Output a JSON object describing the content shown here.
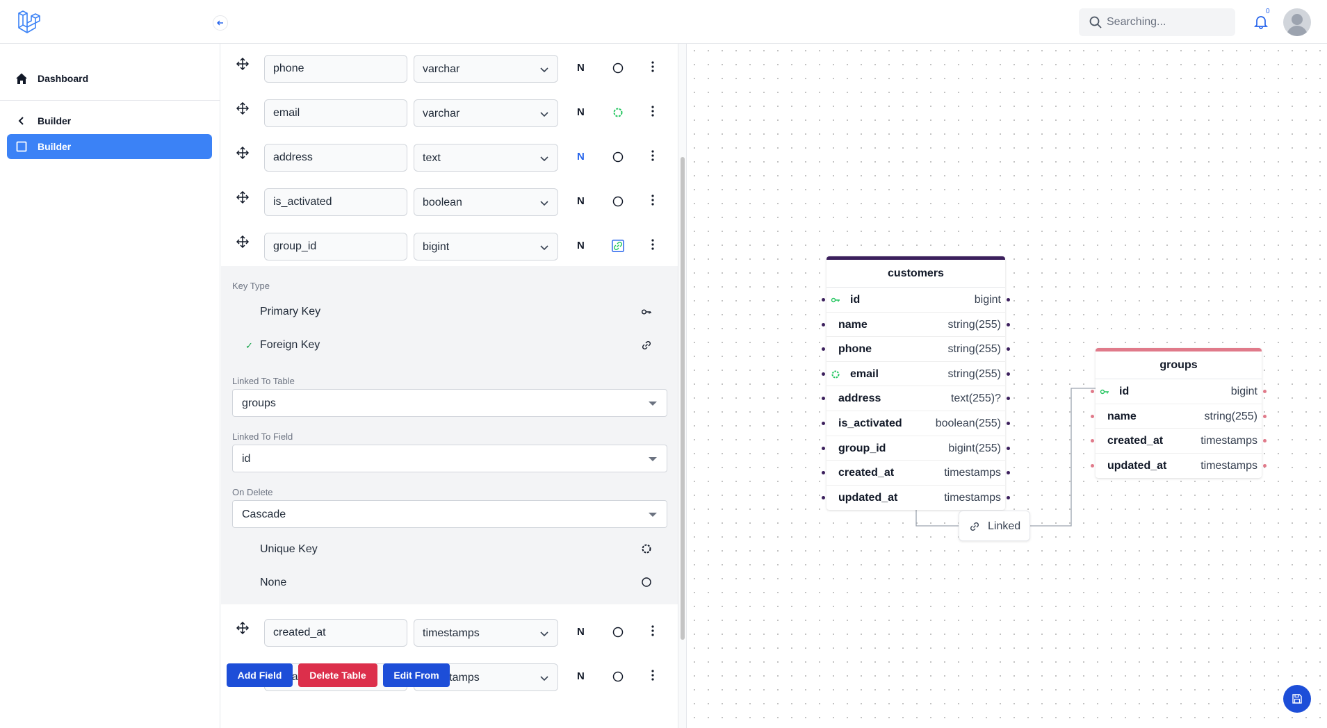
{
  "header": {
    "search_placeholder": "Searching...",
    "notification_count": "0"
  },
  "sidebar": {
    "items": [
      {
        "label": "Dashboard",
        "icon": "home-icon"
      },
      {
        "label": "Builder",
        "icon": "chevron-left-icon"
      },
      {
        "label": "Builder",
        "icon": "square-icon",
        "active": true
      }
    ]
  },
  "fields": [
    {
      "name": "phone",
      "type": "varchar",
      "nullable": "N",
      "key": "none"
    },
    {
      "name": "email",
      "type": "varchar",
      "nullable": "N",
      "key": "unique"
    },
    {
      "name": "address",
      "type": "text",
      "nullable": "N",
      "nullable_active": true,
      "key": "none"
    },
    {
      "name": "is_activated",
      "type": "boolean",
      "nullable": "N",
      "key": "none"
    },
    {
      "name": "group_id",
      "type": "bigint",
      "nullable": "N",
      "key": "foreign"
    },
    {
      "name": "created_at",
      "type": "timestamps",
      "nullable": "N",
      "key": "none"
    },
    {
      "name": "updated_at",
      "type": "timestamps",
      "nullable": "N",
      "key": "none"
    }
  ],
  "key_panel": {
    "key_type_label": "Key Type",
    "primary_key": "Primary Key",
    "foreign_key": "Foreign Key",
    "selected_check": "✓",
    "linked_table_label": "Linked To Table",
    "linked_table_value": "groups",
    "linked_field_label": "Linked To Field",
    "linked_field_value": "id",
    "on_delete_label": "On Delete",
    "on_delete_value": "Cascade",
    "unique_key": "Unique Key",
    "none": "None"
  },
  "actions": {
    "add_field": "Add Field",
    "delete_table": "Delete Table",
    "edit_from": "Edit From"
  },
  "diagram": {
    "customers": {
      "title": "customers",
      "accent": "#3b1f5c",
      "columns": [
        {
          "name": "id",
          "type": "bigint",
          "icon": "primary-key-icon"
        },
        {
          "name": "name",
          "type": "string(255)"
        },
        {
          "name": "phone",
          "type": "string(255)"
        },
        {
          "name": "email",
          "type": "string(255)",
          "icon": "unique-key-icon"
        },
        {
          "name": "address",
          "type": "text(255)?"
        },
        {
          "name": "is_activated",
          "type": "boolean(255)"
        },
        {
          "name": "group_id",
          "type": "bigint(255)"
        },
        {
          "name": "created_at",
          "type": "timestamps"
        },
        {
          "name": "updated_at",
          "type": "timestamps"
        }
      ]
    },
    "groups": {
      "title": "groups",
      "accent": "#e07a8a",
      "columns": [
        {
          "name": "id",
          "type": "bigint",
          "icon": "primary-key-icon"
        },
        {
          "name": "name",
          "type": "string(255)"
        },
        {
          "name": "created_at",
          "type": "timestamps"
        },
        {
          "name": "updated_at",
          "type": "timestamps"
        }
      ]
    },
    "relation_label": "Linked"
  }
}
